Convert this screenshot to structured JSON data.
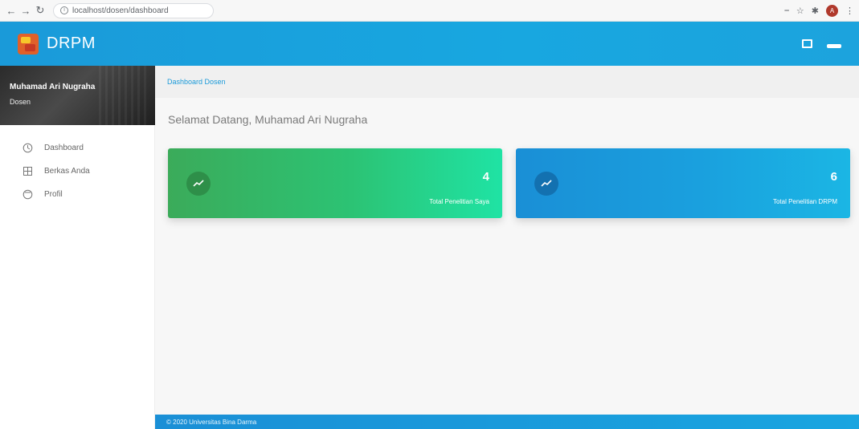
{
  "browser": {
    "url": "localhost/dosen/dashboard",
    "profile_initial": "A"
  },
  "header": {
    "brand": "DRPM"
  },
  "sidebar": {
    "user_name": "Muhamad Ari Nugraha",
    "user_role": "Dosen",
    "items": [
      {
        "label": "Dashboard",
        "icon": "dashboard-icon"
      },
      {
        "label": "Berkas Anda",
        "icon": "grid-icon"
      },
      {
        "label": "Profil",
        "icon": "user-circle-icon"
      }
    ]
  },
  "main": {
    "breadcrumb": "Dashboard Dosen",
    "welcome": "Selamat Datang, Muhamad Ari Nugraha",
    "cards": [
      {
        "value": "4",
        "label": "Total Penelitian Saya",
        "color": "#2cc374"
      },
      {
        "value": "6",
        "label": "Total Penelitian DRPM",
        "color": "#1aa0de"
      }
    ]
  },
  "footer": {
    "text": "© 2020 Universitas Bina Darma"
  },
  "colors": {
    "accent": "#1a9ad9",
    "header": "#18a7e0"
  }
}
